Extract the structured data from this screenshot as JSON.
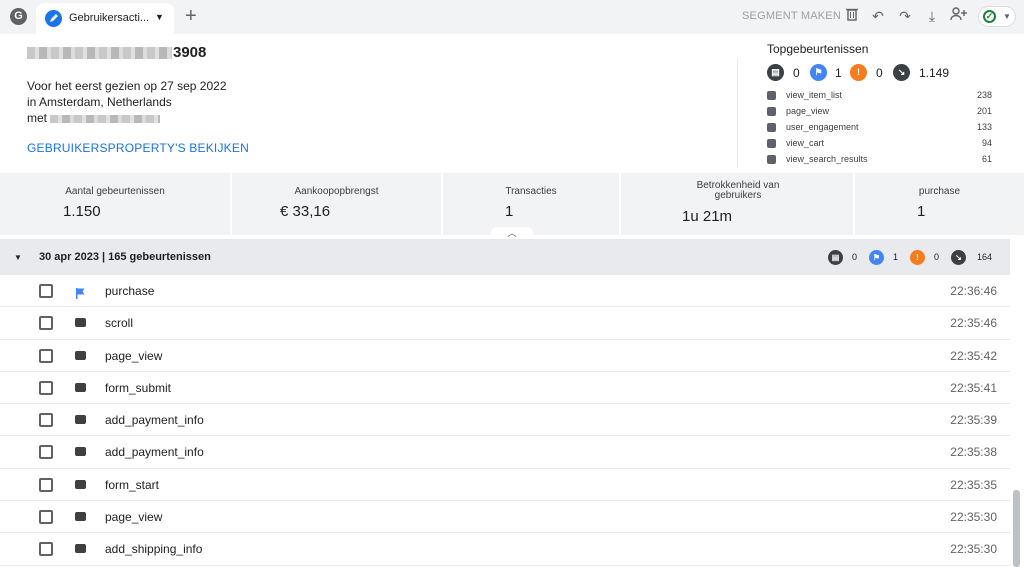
{
  "tabbar": {
    "app_letter": "G",
    "tab_label": "Gebruikersacti...",
    "add_tab": "+",
    "segment_make": "SEGMENT MAKEN"
  },
  "user": {
    "id_suffix": "3908",
    "first_seen_prefix": "Voor het eerst gezien op ",
    "first_seen_date": "27 sep 2022",
    "location_prefix": "in ",
    "location": "Amsterdam, Netherlands",
    "device_prefix": "met",
    "props_link": "GEBRUIKERSPROPERTY'S BEKIJKEN"
  },
  "top_events": {
    "title": "Topgebeurtenissen",
    "counts": {
      "dark": "0",
      "flag": "1",
      "warn": "0",
      "generic": "1.149"
    },
    "items": [
      {
        "name": "view_item_list",
        "count": "238"
      },
      {
        "name": "page_view",
        "count": "201"
      },
      {
        "name": "user_engagement",
        "count": "133"
      },
      {
        "name": "view_cart",
        "count": "94"
      },
      {
        "name": "view_search_results",
        "count": "61"
      }
    ]
  },
  "stats": [
    {
      "label": "Aantal gebeurtenissen",
      "value": "1.150"
    },
    {
      "label": "Aankoopopbrengst",
      "value": "€ 33,16"
    },
    {
      "label": "Transacties",
      "value": "1"
    },
    {
      "label": "Betrokkenheid van gebruikers",
      "value": "1u 21m"
    },
    {
      "label": "purchase",
      "value": "1"
    }
  ],
  "day": {
    "title": "30 apr 2023 | 165 gebeurtenissen",
    "counts": {
      "dark": "0",
      "flag": "1",
      "warn": "0",
      "generic": "164"
    }
  },
  "events": [
    {
      "name": "purchase",
      "time": "22:36:46",
      "icon": "flag-icon"
    },
    {
      "name": "scroll",
      "time": "22:35:46",
      "icon": "event-icon"
    },
    {
      "name": "page_view",
      "time": "22:35:42",
      "icon": "event-icon"
    },
    {
      "name": "form_submit",
      "time": "22:35:41",
      "icon": "event-icon"
    },
    {
      "name": "add_payment_info",
      "time": "22:35:39",
      "icon": "event-icon"
    },
    {
      "name": "add_payment_info",
      "time": "22:35:38",
      "icon": "event-icon"
    },
    {
      "name": "form_start",
      "time": "22:35:35",
      "icon": "event-icon"
    },
    {
      "name": "page_view",
      "time": "22:35:30",
      "icon": "event-icon"
    },
    {
      "name": "add_shipping_info",
      "time": "22:35:30",
      "icon": "event-icon"
    }
  ],
  "colors": {
    "accent": "#1a73e8",
    "flag": "#4285f4",
    "warn": "#f57c1f",
    "ok": "#188038"
  }
}
